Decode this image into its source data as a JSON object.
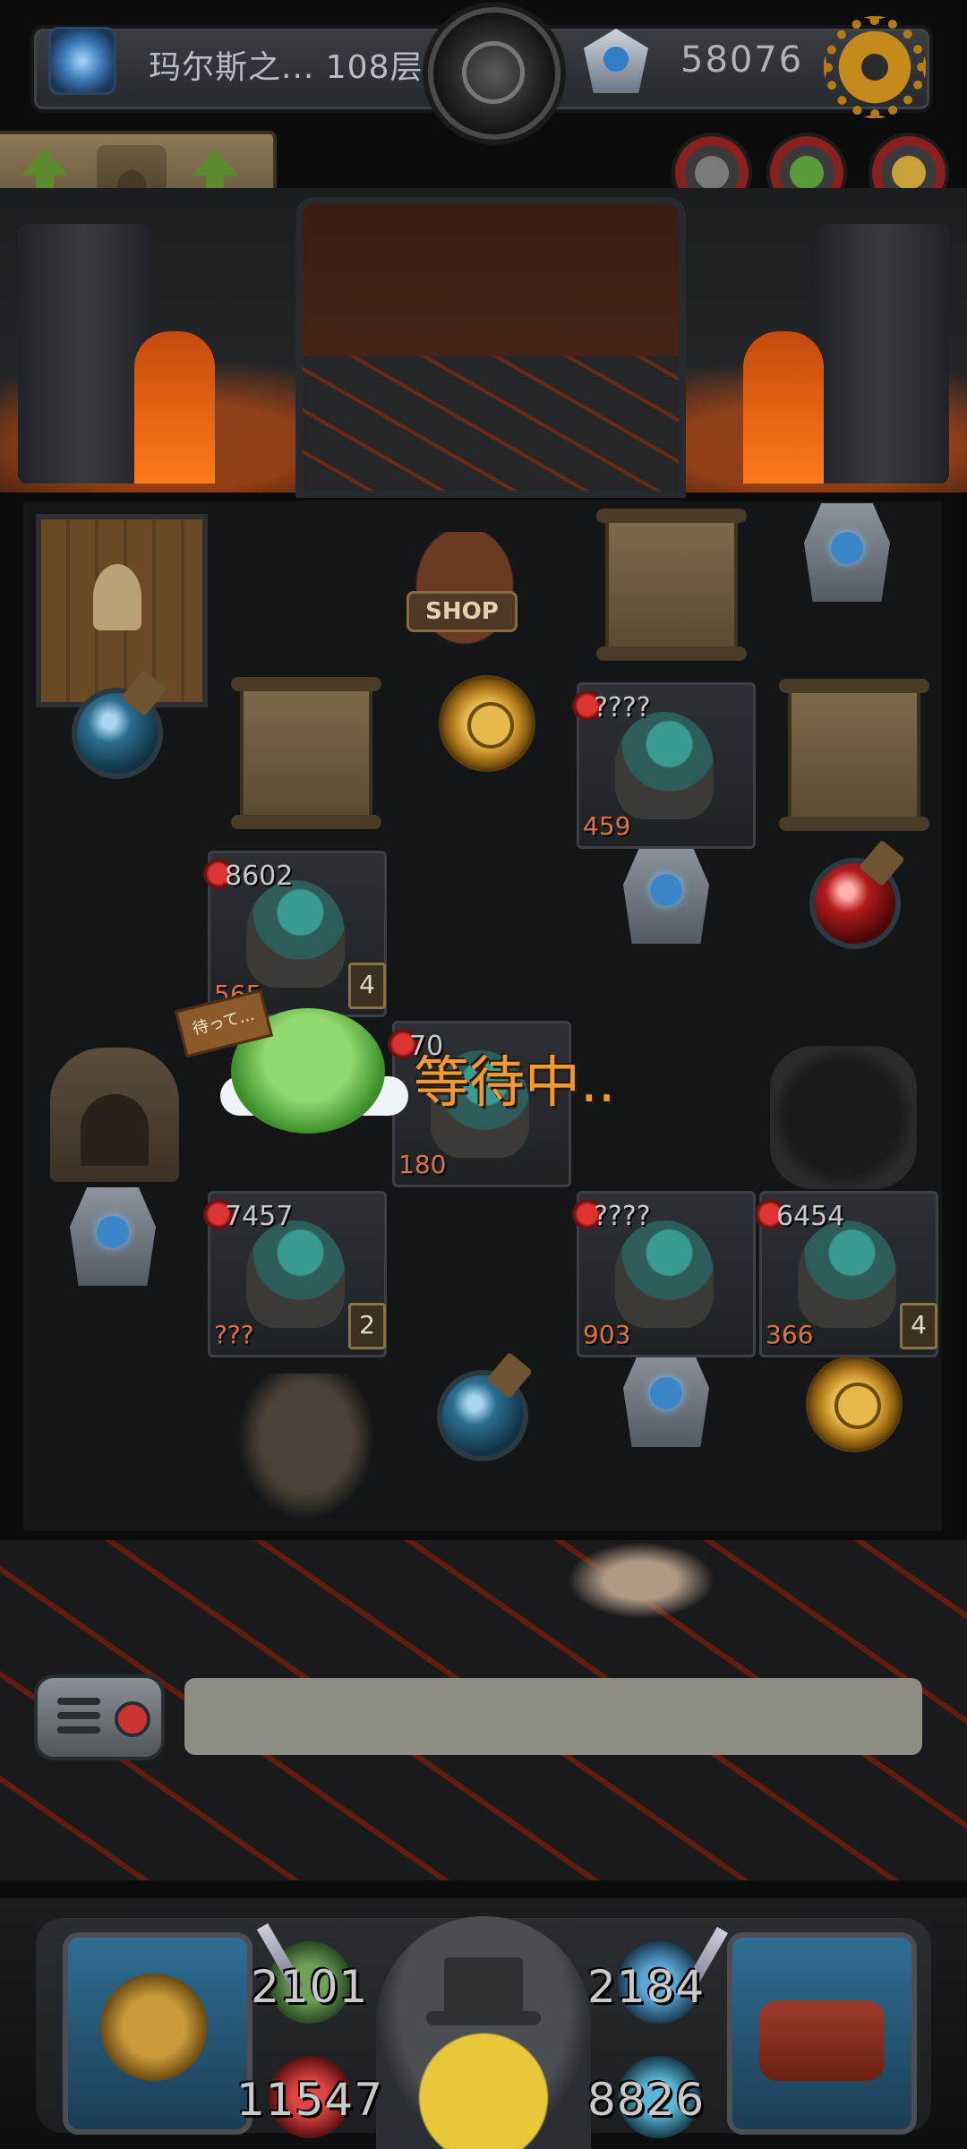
{
  "topbar": {
    "floor_label": "玛尔斯之... 108层",
    "gold": "58076",
    "portal_icon": "portal-icon",
    "gem_icon": "gem-icon",
    "settings_icon": "gear-icon"
  },
  "skill_buttons": [
    {
      "icon": "skill-knight-icon",
      "color": "#7a7a7a"
    },
    {
      "icon": "skill-slime-icon",
      "color": "#5a9c3a"
    },
    {
      "icon": "skill-hero-icon",
      "color": "#c9a13a"
    }
  ],
  "board": {
    "shop_label": "SHOP",
    "enemies": [
      {
        "atk": "????",
        "hp": "459",
        "def": ""
      },
      {
        "atk": "8602",
        "hp": "565",
        "def": "4"
      },
      {
        "atk": "70",
        "hp": "180",
        "def": ""
      },
      {
        "atk": "7457",
        "hp": "???",
        "def": "2"
      },
      {
        "atk": "????",
        "hp": "903",
        "def": ""
      },
      {
        "atk": "6454",
        "hp": "366",
        "def": "4"
      }
    ],
    "hero_sign": "待って...",
    "status_text": "等待中.."
  },
  "message": {
    "text": ""
  },
  "hud": {
    "attack": "2101",
    "defense": "2184",
    "hp": "11547",
    "mp": "8826"
  }
}
